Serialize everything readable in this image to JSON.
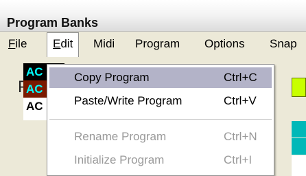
{
  "window": {
    "title": "Program Banks"
  },
  "menubar": {
    "items": [
      {
        "label": "File",
        "mnemonic": "F",
        "rest": "ile"
      },
      {
        "label": "Edit",
        "mnemonic": "E",
        "rest": "dit"
      },
      {
        "label": "Midi"
      },
      {
        "label": "Program"
      },
      {
        "label": "Options"
      },
      {
        "label": "Snap"
      }
    ]
  },
  "panel": {
    "title_partial": "Prc"
  },
  "list": {
    "rows": [
      "AC",
      "AC",
      "AC"
    ]
  },
  "dropdown": {
    "items": [
      {
        "label": "Copy Program",
        "shortcut": "Ctrl+C",
        "state": "highlighted"
      },
      {
        "label": "Paste/Write Program",
        "shortcut": "Ctrl+V",
        "state": "enabled"
      },
      {
        "label": "Rename Program",
        "shortcut": "Ctrl+N",
        "state": "disabled"
      },
      {
        "label": "Initialize Program",
        "shortcut": "Ctrl+I",
        "state": "disabled"
      }
    ]
  },
  "colors": {
    "highlight": "#b3b3c8",
    "disabled_text": "#9a9a9a",
    "accent_green": "#c8ff00",
    "list_cyan": "#00ffff"
  }
}
